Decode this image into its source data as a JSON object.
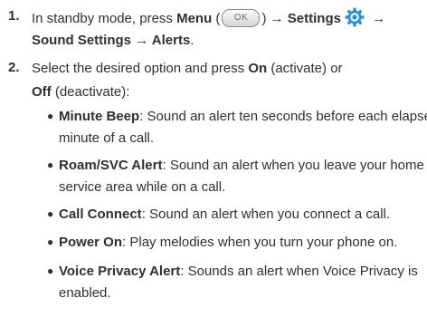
{
  "steps": [
    {
      "number": "1.",
      "prefix": "In standby mode, press ",
      "menu_label": "Menu",
      "paren_open": " (",
      "ok_key": "OK",
      "paren_close": ") ",
      "arrow1": "→ ",
      "settings_label": "Settings",
      "arrow2": " →",
      "line2": "Sound Settings → Alerts",
      "line2_end": "."
    },
    {
      "number": "2.",
      "prefix": "Select the desired option and press ",
      "on_label": "On",
      "on_desc": " (activate) or",
      "off_label": "Off",
      "off_desc": " (deactivate):"
    }
  ],
  "options": [
    {
      "name": "Minute Beep",
      "desc_line1": ": Sound an alert ten seconds before each elapsed",
      "desc_line2": "minute of a call."
    },
    {
      "name": "Roam/SVC Alert",
      "desc_line1": ": Sound an alert when you leave your home",
      "desc_line2": "service area while on a call."
    },
    {
      "name": "Call Connect",
      "desc_line1": ": Sound an alert when you connect a call.",
      "desc_line2": ""
    },
    {
      "name": "Power On",
      "desc_line1": ": Play melodies when you turn your phone on.",
      "desc_line2": ""
    },
    {
      "name": "Voice Privacy Alert",
      "desc_line1": ": Sounds an alert when Voice Privacy is",
      "desc_line2": "enabled."
    }
  ],
  "colors": {
    "text": "#303030",
    "gear_blue": "#2f8fd6"
  },
  "icons": {
    "ok_key": "ok-key-icon",
    "settings": "settings-gear-icon"
  }
}
